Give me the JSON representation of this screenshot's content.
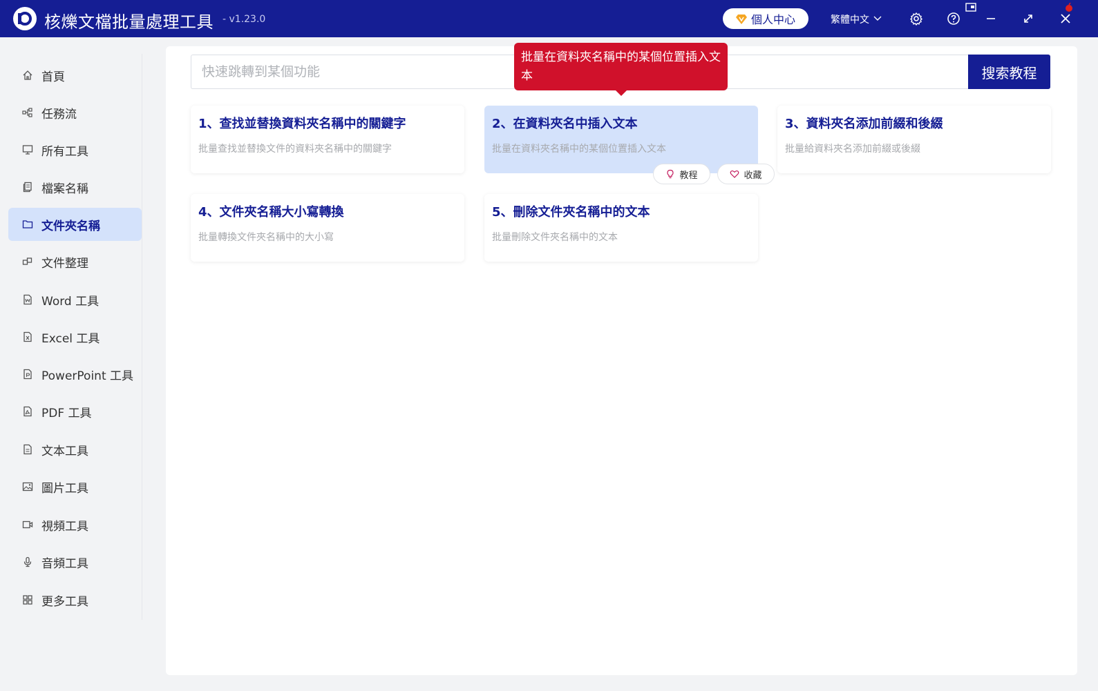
{
  "app": {
    "title": "核爍文檔批量處理工具",
    "version": "- v1.23.0"
  },
  "titlebar": {
    "user_center": "個人中心",
    "language": "繁體中文",
    "icons": [
      "settings-icon",
      "help-icon",
      "notification-icon",
      "minimize-icon",
      "maximize-icon",
      "close-icon"
    ]
  },
  "sidebar": {
    "items": [
      {
        "label": "首頁",
        "icon": "home-icon"
      },
      {
        "label": "任務流",
        "icon": "workflow-icon"
      },
      {
        "label": "所有工具",
        "icon": "monitor-icon"
      },
      {
        "label": "檔案名稱",
        "icon": "file-copy-icon"
      },
      {
        "label": "文件夾名稱",
        "icon": "folder-icon",
        "active": true
      },
      {
        "label": "文件整理",
        "icon": "organize-icon"
      },
      {
        "label": "Word 工具",
        "icon": "word-file-icon"
      },
      {
        "label": "Excel 工具",
        "icon": "excel-file-icon"
      },
      {
        "label": "PowerPoint 工具",
        "icon": "ppt-file-icon"
      },
      {
        "label": "PDF 工具",
        "icon": "pdf-file-icon"
      },
      {
        "label": "文本工具",
        "icon": "text-file-icon"
      },
      {
        "label": "圖片工具",
        "icon": "image-icon"
      },
      {
        "label": "視頻工具",
        "icon": "video-icon"
      },
      {
        "label": "音頻工具",
        "icon": "microphone-icon"
      },
      {
        "label": "更多工具",
        "icon": "grid-icon"
      }
    ]
  },
  "search": {
    "placeholder": "快速跳轉到某個功能",
    "value": "",
    "button_label": "搜索教程"
  },
  "tooltip": {
    "text": "批量在資料夾名稱中的某個位置插入文本"
  },
  "cards": [
    {
      "title": "1、查找並替換資料夾名稱中的關鍵字",
      "desc": "批量查找並替換文件的資料夾名稱中的關鍵字"
    },
    {
      "title": "2、在資料夾名中插入文本",
      "desc": "批量在資料夾名稱中的某個位置插入文本",
      "hovered": true
    },
    {
      "title": "3、資料夾名添加前綴和後綴",
      "desc": "批量給資料夾名添加前綴或後綴"
    },
    {
      "title": "4、文件夾名稱大小寫轉換",
      "desc": "批量轉換文件夾名稱中的大小寫"
    },
    {
      "title": "5、刪除文件夾名稱中的文本",
      "desc": "批量刪除文件夾名稱中的文本"
    }
  ],
  "card_actions": {
    "tutorial_label": "教程",
    "favorite_label": "收藏"
  },
  "colors": {
    "brand": "#151e94",
    "active_bg": "#d4e2fb",
    "tooltip_bg": "#d0112b",
    "gem": "#f5a623"
  }
}
